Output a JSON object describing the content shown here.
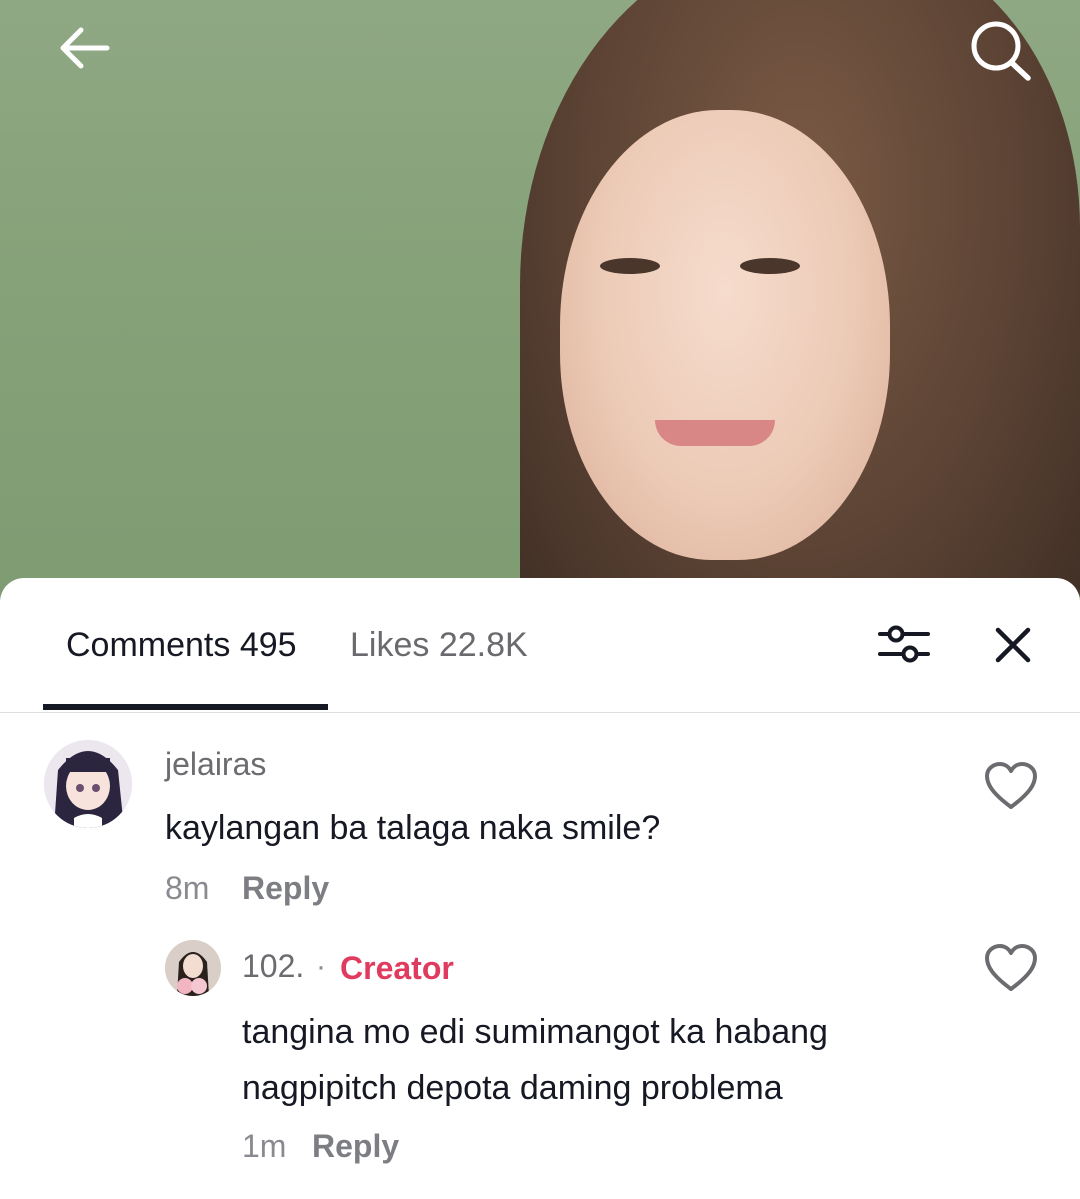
{
  "header": {
    "back_icon": "back-arrow-icon",
    "search_icon": "search-icon"
  },
  "tabs": {
    "comments_label": "Comments 495",
    "likes_label": "Likes 22.8K",
    "filter_icon": "filter-icon",
    "close_icon": "close-icon"
  },
  "comments": [
    {
      "username": "jelairas",
      "text": "kaylangan ba talaga naka smile?",
      "time": "8m",
      "reply_label": "Reply",
      "like_icon": "heart-icon"
    }
  ],
  "replies": [
    {
      "username": "102.",
      "separator": "·",
      "badge": "Creator",
      "text_line1": "tangina mo edi sumimangot ka habang",
      "text_line2": "nagpipitch depota daming problema",
      "time": "1m",
      "reply_label": "Reply",
      "like_icon": "heart-icon"
    }
  ],
  "colors": {
    "creator": "#e13a5f",
    "text_primary": "#161823",
    "text_secondary": "#8a8b91"
  }
}
